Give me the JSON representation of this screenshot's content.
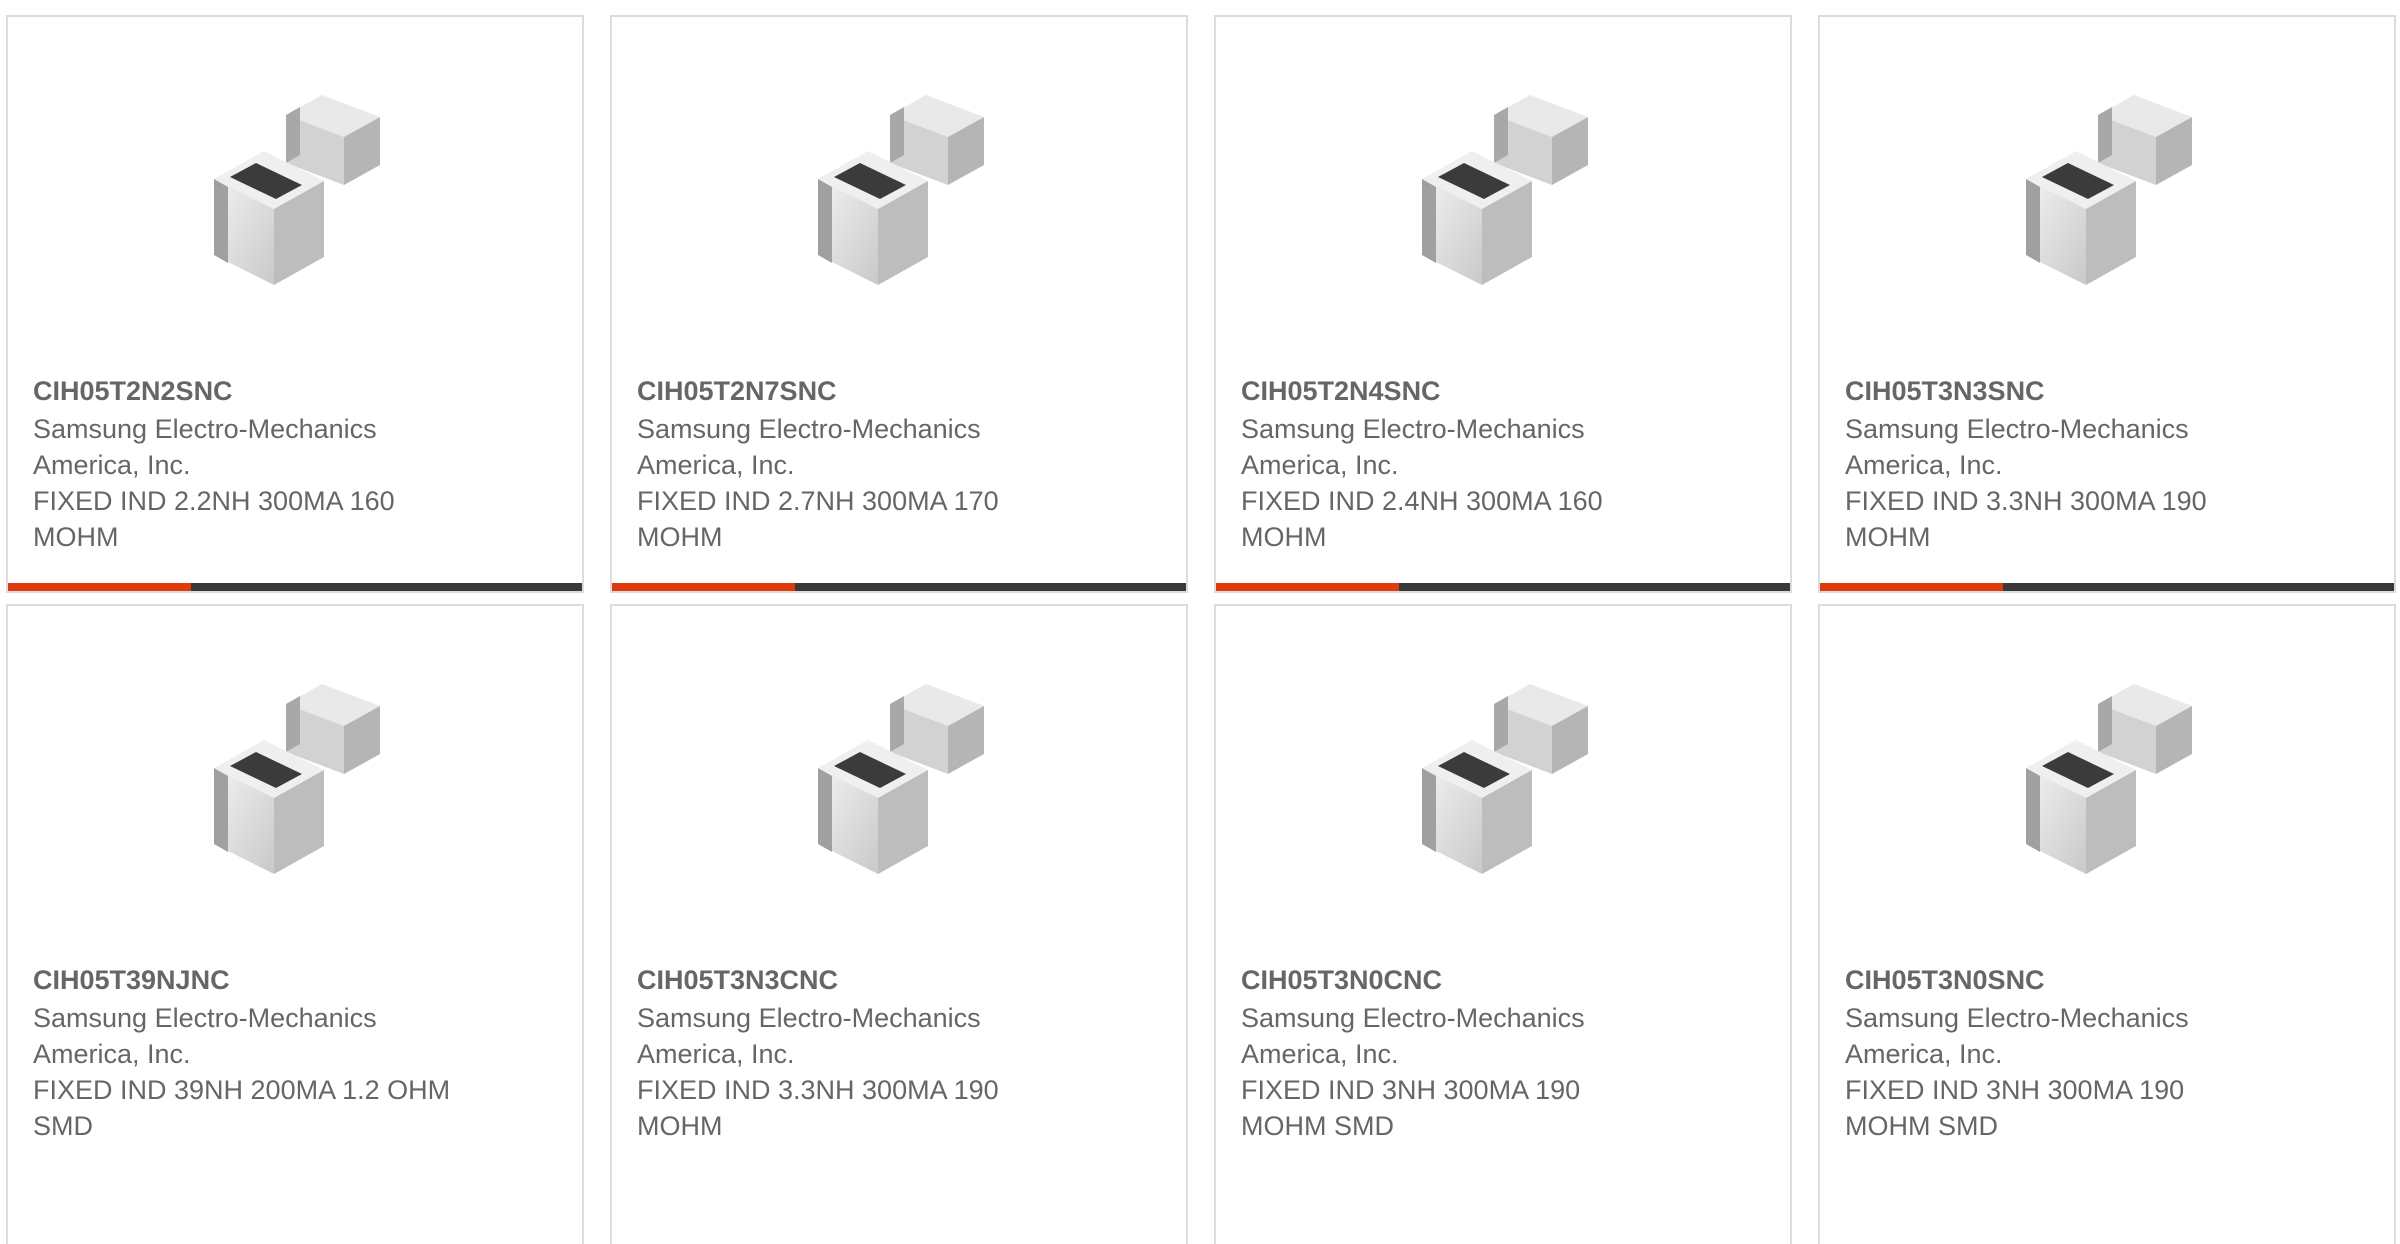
{
  "colors": {
    "accent": "#e03a0f",
    "bar": "#3a3a3a",
    "border": "#dcdcdc",
    "text": "#666666"
  },
  "products": [
    {
      "part_number": "CIH05T2N2SNC",
      "manufacturer": "Samsung Electro-Mechanics America, Inc.",
      "description": "FIXED IND 2.2NH 300MA 160 MOHM",
      "image_icon": "inductor-chip-icon"
    },
    {
      "part_number": "CIH05T2N7SNC",
      "manufacturer": "Samsung Electro-Mechanics America, Inc.",
      "description": "FIXED IND 2.7NH 300MA 170 MOHM",
      "image_icon": "inductor-chip-icon"
    },
    {
      "part_number": "CIH05T2N4SNC",
      "manufacturer": "Samsung Electro-Mechanics America, Inc.",
      "description": "FIXED IND 2.4NH 300MA 160 MOHM",
      "image_icon": "inductor-chip-icon"
    },
    {
      "part_number": "CIH05T3N3SNC",
      "manufacturer": "Samsung Electro-Mechanics America, Inc.",
      "description": "FIXED IND 3.3NH 300MA 190 MOHM",
      "image_icon": "inductor-chip-icon"
    },
    {
      "part_number": "CIH05T39NJNC",
      "manufacturer": "Samsung Electro-Mechanics America, Inc.",
      "description": "FIXED IND 39NH 200MA 1.2 OHM SMD",
      "image_icon": "inductor-chip-icon"
    },
    {
      "part_number": "CIH05T3N3CNC",
      "manufacturer": "Samsung Electro-Mechanics America, Inc.",
      "description": "FIXED IND 3.3NH 300MA 190 MOHM",
      "image_icon": "inductor-chip-icon"
    },
    {
      "part_number": "CIH05T3N0CNC",
      "manufacturer": "Samsung Electro-Mechanics America, Inc.",
      "description": "FIXED IND 3NH 300MA 190 MOHM SMD",
      "image_icon": "inductor-chip-icon"
    },
    {
      "part_number": "CIH05T3N0SNC",
      "manufacturer": "Samsung Electro-Mechanics America, Inc.",
      "description": "FIXED IND 3NH 300MA 190 MOHM SMD",
      "image_icon": "inductor-chip-icon"
    }
  ]
}
